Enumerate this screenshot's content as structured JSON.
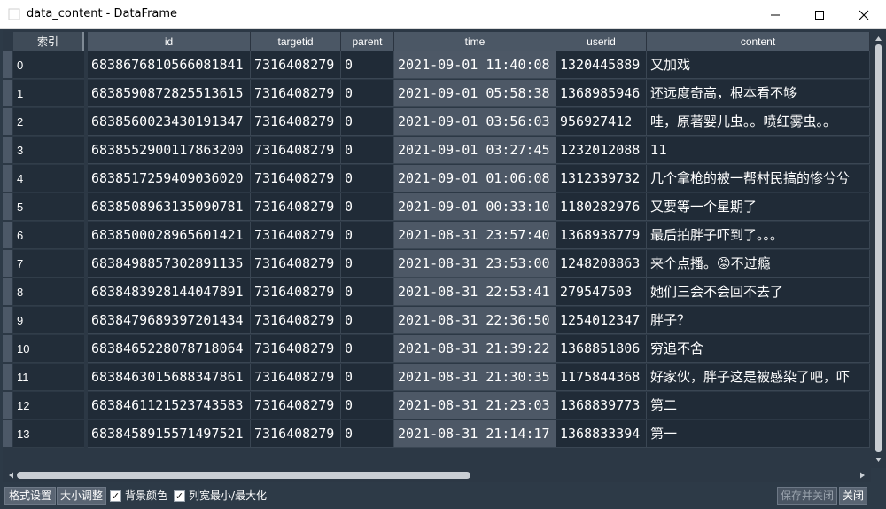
{
  "window": {
    "title": "data_content - DataFrame",
    "minimize_glyph": "—",
    "maximize_glyph": "☐",
    "close_glyph": "✕"
  },
  "table": {
    "index_header": "索引",
    "columns": [
      "id",
      "targetid",
      "parent",
      "time",
      "userid",
      "content"
    ],
    "rows": [
      {
        "index": "0",
        "id": "6838676810566081841",
        "targetid": "7316408279",
        "parent": "0",
        "time": "2021-09-01 11:40:08",
        "userid": "1320445889",
        "content": "又加戏"
      },
      {
        "index": "1",
        "id": "6838590872825513615",
        "targetid": "7316408279",
        "parent": "0",
        "time": "2021-09-01 05:58:38",
        "userid": "1368985946",
        "content": "还远度奇高，根本看不够"
      },
      {
        "index": "2",
        "id": "6838560023430191347",
        "targetid": "7316408279",
        "parent": "0",
        "time": "2021-09-01 03:56:03",
        "userid": "956927412",
        "content": "哇，原著婴儿虫。。喷红雾虫。。"
      },
      {
        "index": "3",
        "id": "6838552900117863200",
        "targetid": "7316408279",
        "parent": "0",
        "time": "2021-09-01 03:27:45",
        "userid": "1232012088",
        "content": "11"
      },
      {
        "index": "4",
        "id": "6838517259409036020",
        "targetid": "7316408279",
        "parent": "0",
        "time": "2021-09-01 01:06:08",
        "userid": "1312339732",
        "content": "几个拿枪的被一帮村民搞的惨兮兮"
      },
      {
        "index": "5",
        "id": "6838508963135090781",
        "targetid": "7316408279",
        "parent": "0",
        "time": "2021-09-01 00:33:10",
        "userid": "1180282976",
        "content": "又要等一个星期了"
      },
      {
        "index": "6",
        "id": "6838500028965601421",
        "targetid": "7316408279",
        "parent": "0",
        "time": "2021-08-31 23:57:40",
        "userid": "1368938779",
        "content": "最后拍胖子吓到了。。。"
      },
      {
        "index": "7",
        "id": "6838498857302891135",
        "targetid": "7316408279",
        "parent": "0",
        "time": "2021-08-31 23:53:00",
        "userid": "1248208863",
        "content": "来个点播。😡不过瘾"
      },
      {
        "index": "8",
        "id": "6838483928144047891",
        "targetid": "7316408279",
        "parent": "0",
        "time": "2021-08-31 22:53:41",
        "userid": "279547503",
        "content": "她们三会不会回不去了"
      },
      {
        "index": "9",
        "id": "6838479689397201434",
        "targetid": "7316408279",
        "parent": "0",
        "time": "2021-08-31 22:36:50",
        "userid": "1254012347",
        "content": "胖子？"
      },
      {
        "index": "10",
        "id": "6838465228078718064",
        "targetid": "7316408279",
        "parent": "0",
        "time": "2021-08-31 21:39:22",
        "userid": "1368851806",
        "content": "穷追不舍"
      },
      {
        "index": "11",
        "id": "6838463015688347861",
        "targetid": "7316408279",
        "parent": "0",
        "time": "2021-08-31 21:30:35",
        "userid": "1175844368",
        "content": "好家伙，胖子这是被感染了吧，吓"
      },
      {
        "index": "12",
        "id": "6838461121523743583",
        "targetid": "7316408279",
        "parent": "0",
        "time": "2021-08-31 21:23:03",
        "userid": "1368839773",
        "content": "第二"
      },
      {
        "index": "13",
        "id": "6838458915571497521",
        "targetid": "7316408279",
        "parent": "0",
        "time": "2021-08-31 21:14:17",
        "userid": "1368833394",
        "content": "第一"
      }
    ]
  },
  "toolbar": {
    "format_settings": "格式设置",
    "resize": "大小调整",
    "background_color": "背景颜色",
    "background_color_checked": true,
    "column_width_minmax": "列宽最小/最大化",
    "column_width_minmax_checked": true,
    "save_and_close": "保存并关闭",
    "close": "关闭"
  },
  "colors": {
    "background": "#2d3a47",
    "cell_bg": "#202b37",
    "header_bg": "#4b5765",
    "highlight_column_bg": "#4d5866",
    "text": "#ffffff"
  }
}
